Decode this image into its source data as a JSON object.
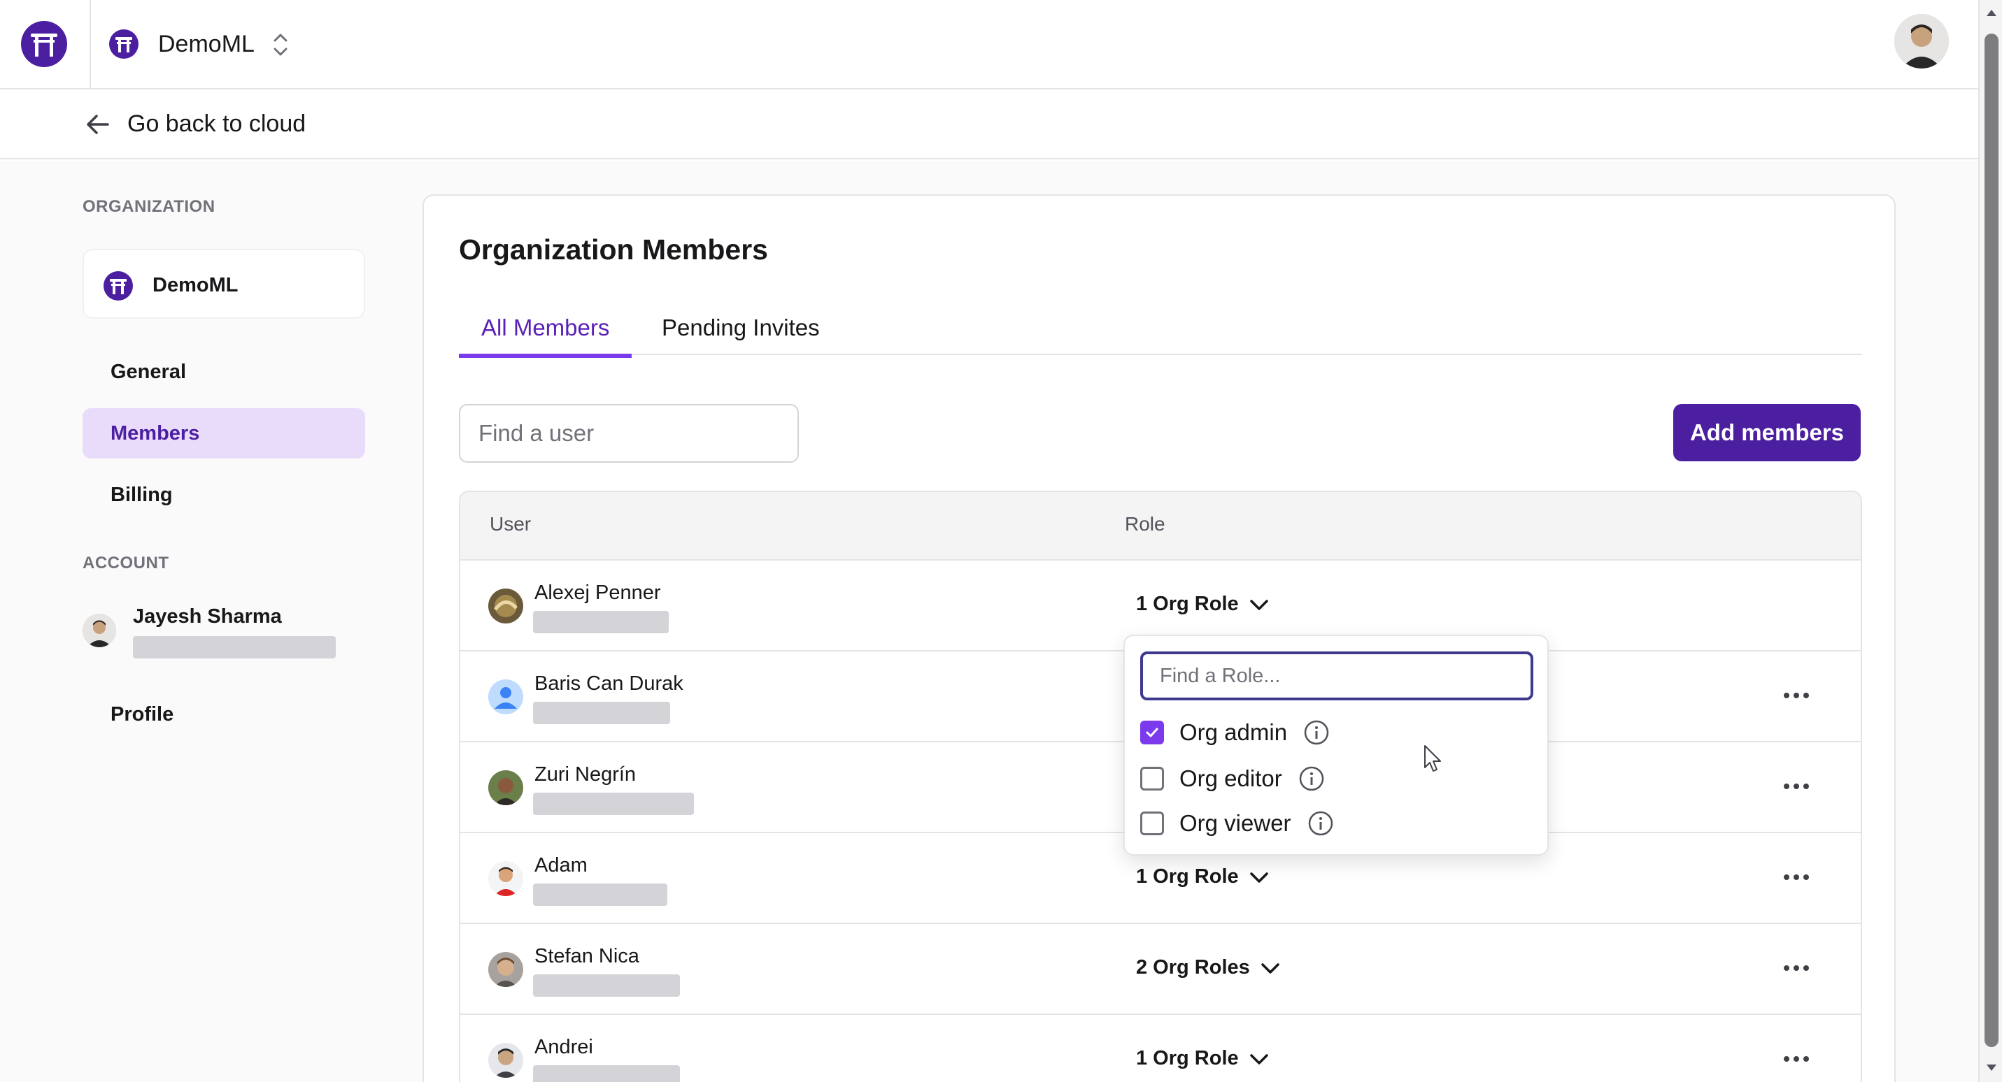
{
  "app": {
    "org_name": "DemoML",
    "back_label": "Go back to cloud"
  },
  "sidebar": {
    "organization_section": "ORGANIZATION",
    "org_card_name": "DemoML",
    "items": [
      {
        "label": "General"
      },
      {
        "label": "Members",
        "active": true
      },
      {
        "label": "Billing"
      }
    ],
    "account_section": "ACCOUNT",
    "account_name": "Jayesh Sharma",
    "profile_label": "Profile"
  },
  "main": {
    "title": "Organization Members",
    "tabs": [
      {
        "label": "All Members",
        "active": true
      },
      {
        "label": "Pending Invites"
      }
    ],
    "search_placeholder": "Find a user",
    "add_button": "Add members",
    "table": {
      "columns": [
        "User",
        "Role"
      ],
      "rows": [
        {
          "name": "Alexej Penner",
          "role": "1 Org Role"
        },
        {
          "name": "Baris Can Durak",
          "role": ""
        },
        {
          "name": "Zuri Negrín",
          "role": ""
        },
        {
          "name": "Adam",
          "role": "1 Org Role"
        },
        {
          "name": "Stefan Nica",
          "role": "2 Org Roles"
        },
        {
          "name": "Andrei",
          "role": "1 Org Role"
        }
      ]
    }
  },
  "role_dropdown": {
    "placeholder": "Find a Role...",
    "options": [
      {
        "label": "Org admin",
        "checked": true
      },
      {
        "label": "Org editor",
        "checked": false
      },
      {
        "label": "Org viewer",
        "checked": false
      }
    ]
  },
  "colors": {
    "brand": "#4b1fa0",
    "accent": "#7c3aed",
    "active_nav_bg": "#e9dcfb"
  }
}
